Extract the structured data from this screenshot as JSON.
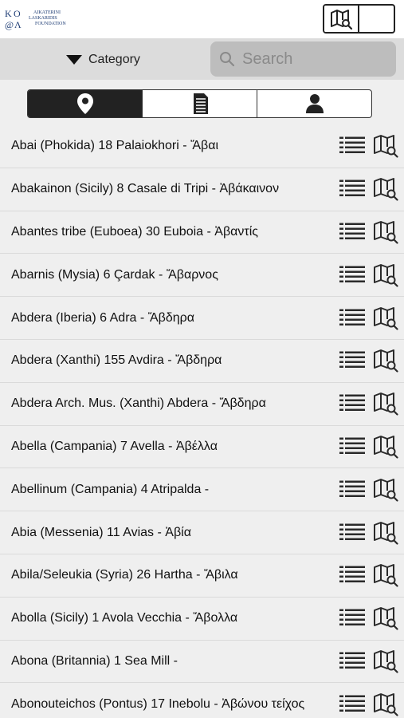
{
  "header": {
    "logo": {
      "monogram": "Κ Ο\n@ Λ",
      "name_lines": [
        "AIKATERINI",
        "LASKARIDIS",
        "FOUNDATION"
      ]
    },
    "view_toggle": {
      "map_icon": "map-search-icon",
      "list_icon": "list-icon",
      "active": "list"
    }
  },
  "filter": {
    "category_label": "Category",
    "search_placeholder": "Search"
  },
  "tabs": [
    {
      "icon": "location-pin-icon",
      "active": true
    },
    {
      "icon": "document-icon",
      "active": false
    },
    {
      "icon": "person-icon",
      "active": false
    }
  ],
  "places": [
    {
      "label": "Abai (Phokida) 18 Palaiokhori - Ἄβαι"
    },
    {
      "label": "Abakainon (Sicily) 8 Casale di Tripi - Ἀβάκαινον"
    },
    {
      "label": "Abantes tribe (Euboea) 30 Euboia - Ἀβαντίς"
    },
    {
      "label": "Abarnis (Mysia) 6 Çardak - Ἄβαρνος"
    },
    {
      "label": "Abdera (Iberia) 6 Adra - Ἄβδηρα"
    },
    {
      "label": "Abdera (Xanthi) 155 Avdira - Ἄβδηρα"
    },
    {
      "label": "Abdera Arch. Mus. (Xanthi)  Abdera - Ἄβδηρα"
    },
    {
      "label": "Abella (Campania) 7 Avella - Ἀβέλλα"
    },
    {
      "label": "Abellinum (Campania) 4 Atripalda -"
    },
    {
      "label": "Abia (Messenia) 11 Avias - Ἀβία"
    },
    {
      "label": "Abila/Seleukia (Syria) 26 Hartha - Ἄβιλα"
    },
    {
      "label": "Abolla (Sicily) 1 Avola Vecchia - Ἄβολλα"
    },
    {
      "label": "Abona (Britannia) 1 Sea Mill -"
    },
    {
      "label": "Abonouteichos (Pontus) 17 Inebolu - Ἀβώνου τείχος"
    }
  ]
}
